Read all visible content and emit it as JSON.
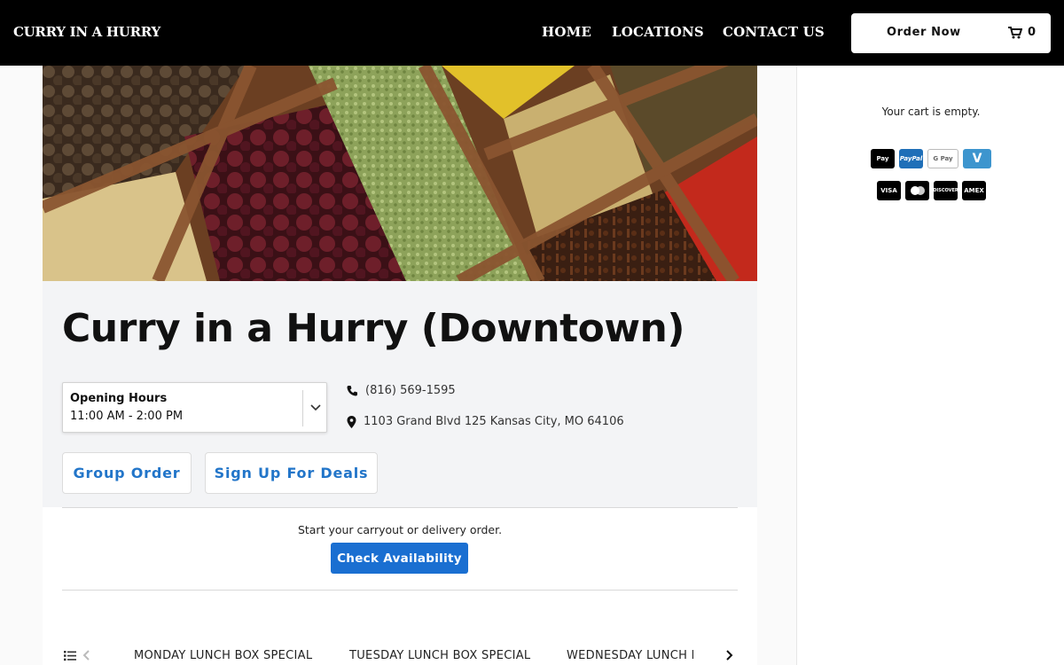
{
  "header": {
    "brand": "CURRY IN A HURRY",
    "nav": [
      {
        "label": "HOME"
      },
      {
        "label": "LOCATIONS"
      },
      {
        "label": "CONTACT US"
      }
    ],
    "order_label": "Order Now",
    "cart_count": "0",
    "cart_icon": "shopping-cart-icon"
  },
  "sidebar": {
    "cart_empty": "Your cart is empty.",
    "payment_methods": [
      {
        "name": "Apple Pay",
        "label": "Pay",
        "color": "#000000"
      },
      {
        "name": "PayPal",
        "label": "PayPal",
        "color": "#1f6fb8"
      },
      {
        "name": "Google Pay",
        "label": "G Pay",
        "color": "#ffffff"
      },
      {
        "name": "Venmo",
        "label": "V",
        "color": "#3d95ce"
      },
      {
        "name": "Visa",
        "label": "VISA",
        "color": "#000000"
      },
      {
        "name": "Mastercard",
        "label": "",
        "color": "#000000"
      },
      {
        "name": "Discover",
        "label": "DISCOVER",
        "color": "#000000"
      },
      {
        "name": "American Express",
        "label": "AMEX",
        "color": "#000000"
      }
    ]
  },
  "restaurant": {
    "name": "Curry in a Hurry (Downtown)",
    "hours_title": "Opening Hours",
    "hours_value": "11:00 AM - 2:00 PM",
    "phone": "(816) 569-1595",
    "address": "1103 Grand Blvd 125 Kansas City, MO 64106",
    "group_order": "Group Order",
    "deals": "Sign Up For Deals"
  },
  "ordering": {
    "prompt": "Start your carryout or delivery order.",
    "check_label": "Check Availability"
  },
  "categories": [
    {
      "label": "MONDAY LUNCH BOX SPECIAL"
    },
    {
      "label": "TUESDAY LUNCH BOX SPECIAL"
    },
    {
      "label": "WEDNESDAY LUNCH B"
    }
  ],
  "colors": {
    "accent": "#1a6fd1",
    "link": "#2275c9",
    "header_bg": "#000000"
  }
}
